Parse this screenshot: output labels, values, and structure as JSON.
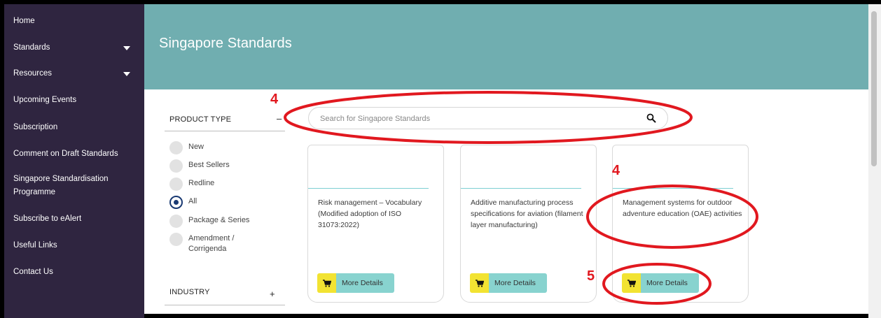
{
  "sidebar": {
    "items": [
      {
        "label": "Home",
        "has_caret": false
      },
      {
        "label": "Standards",
        "has_caret": true
      },
      {
        "label": "Resources",
        "has_caret": true
      },
      {
        "label": "Upcoming Events",
        "has_caret": false
      },
      {
        "label": "Subscription",
        "has_caret": false
      },
      {
        "label": "Comment on Draft Standards",
        "has_caret": false
      },
      {
        "label": "Singapore Standardisation Programme",
        "has_caret": false
      },
      {
        "label": "Subscribe to eAlert",
        "has_caret": false
      },
      {
        "label": "Useful Links",
        "has_caret": false
      },
      {
        "label": "Contact Us",
        "has_caret": false
      }
    ]
  },
  "header": {
    "title": "Singapore Standards"
  },
  "filters": {
    "product_type": {
      "title": "PRODUCT TYPE",
      "toggle": "–",
      "options": [
        {
          "label": "New",
          "checked": false
        },
        {
          "label": "Best Sellers",
          "checked": false
        },
        {
          "label": "Redline",
          "checked": false
        },
        {
          "label": "All",
          "checked": true
        },
        {
          "label": "Package & Series",
          "checked": false
        },
        {
          "label": "Amendment / Corrigenda",
          "checked": false
        }
      ]
    },
    "industry": {
      "title": "INDUSTRY",
      "toggle": "+"
    }
  },
  "search": {
    "placeholder": "Search for Singapore Standards",
    "value": "",
    "icon": "search-icon"
  },
  "cards": [
    {
      "title": "Risk management – Vocabulary (Modified adoption of ISO 31073:2022)",
      "button": "More Details"
    },
    {
      "title": "Additive manufacturing process specifications for aviation (filament layer manufacturing)",
      "button": "More Details"
    },
    {
      "title": "Management systems for outdoor adventure education (OAE) activities",
      "button": "More Details"
    }
  ],
  "annotations": {
    "search_label": "4",
    "card_label": "4",
    "button_label": "5",
    "color": "#e1181f"
  },
  "colors": {
    "sidebar_bg": "#2f2540",
    "banner_bg": "#70aeb0",
    "cart_yellow": "#f2e332",
    "button_teal": "#88d3cf",
    "radio_checked": "#1a3a73"
  }
}
